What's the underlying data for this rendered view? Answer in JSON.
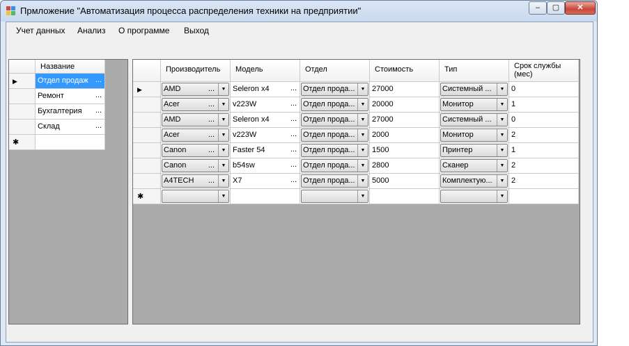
{
  "window": {
    "title": "Прмложение \"Автоматизация процесса распределения техники на предприятии\"",
    "controls": {
      "minimize": "–",
      "maximize": "▢",
      "close": "✕"
    }
  },
  "menu": [
    "Учет данных",
    "Анализ",
    "О программе",
    "Выход"
  ],
  "departments_grid": {
    "column": "Название",
    "current_row_marker": "▶",
    "new_row_marker": "✱",
    "ellipsis": "...",
    "rows": [
      "Отдел продаж",
      "Ремонт",
      "Бухгалтерия",
      "Склад"
    ]
  },
  "equipment_grid": {
    "columns": [
      "Производитель",
      "Модель",
      "Отдел",
      "Стоимость",
      "Тип",
      "Срок службы (мес)"
    ],
    "current_row_marker": "▶",
    "new_row_marker": "✱",
    "ellipsis": "...",
    "dropdown_arrow": "▼",
    "rows": [
      {
        "manufacturer": "AMD",
        "model": "Seleron x4",
        "department": "Отдел прода...",
        "cost": "27000",
        "type": "Системный ...",
        "life": "0"
      },
      {
        "manufacturer": "Acer",
        "model": "v223W",
        "department": "Отдел прода...",
        "cost": "20000",
        "type": "Монитор",
        "life": "1"
      },
      {
        "manufacturer": "AMD",
        "model": "Seleron x4",
        "department": "Отдел прода...",
        "cost": "27000",
        "type": "Системный ...",
        "life": "0"
      },
      {
        "manufacturer": "Acer",
        "model": "v223W",
        "department": "Отдел прода...",
        "cost": "2000",
        "type": "Монитор",
        "life": "2"
      },
      {
        "manufacturer": "Canon",
        "model": "Faster 54",
        "department": "Отдел прода...",
        "cost": "1500",
        "type": "Принтер",
        "life": "1"
      },
      {
        "manufacturer": "Canon",
        "model": "b54sw",
        "department": "Отдел прода...",
        "cost": "2800",
        "type": "Сканер",
        "life": "2"
      },
      {
        "manufacturer": "A4TECH",
        "model": "X7",
        "department": "Отдел прода...",
        "cost": "5000",
        "type": "Комплектую...",
        "life": "2"
      }
    ]
  },
  "colors": {
    "selection": "#3399ff",
    "grid_background": "#ababab",
    "window_frame": "#dfe9f5"
  }
}
